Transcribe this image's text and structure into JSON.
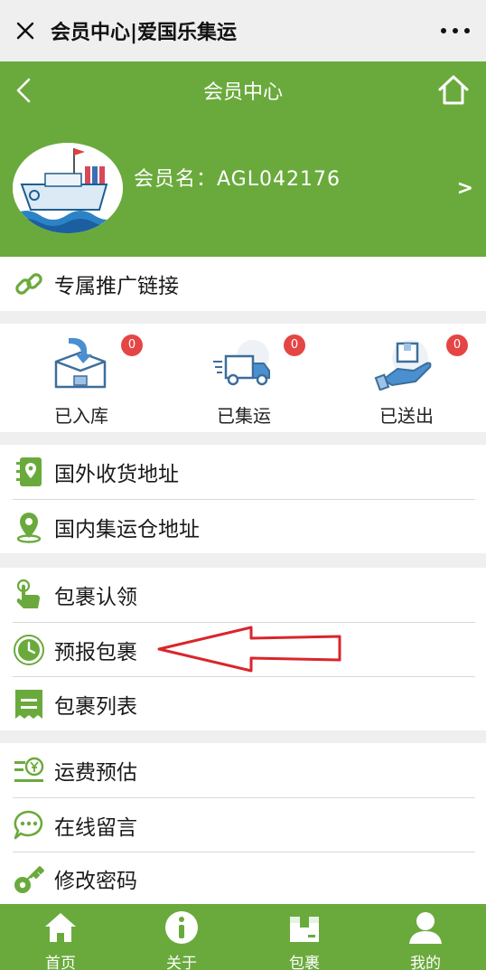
{
  "window": {
    "title": "会员中心|爱国乐集运"
  },
  "navbar": {
    "title": "会员中心"
  },
  "profile": {
    "username": "会员名：AGL042176",
    "arrow": ">"
  },
  "promo": {
    "label": "专属推广链接"
  },
  "stats": [
    {
      "label": "已入库",
      "count": "0"
    },
    {
      "label": "已集运",
      "count": "0"
    },
    {
      "label": "已送出",
      "count": "0"
    }
  ],
  "menu_group1": [
    {
      "label": "国外收货地址",
      "icon": "address-book-pin-icon"
    },
    {
      "label": "国内集运仓地址",
      "icon": "map-pin-icon"
    }
  ],
  "menu_group2": [
    {
      "label": "包裹认领",
      "icon": "hand-pointer-icon"
    },
    {
      "label": "预报包裹",
      "icon": "clock-icon"
    },
    {
      "label": "包裹列表",
      "icon": "list-receipt-icon"
    }
  ],
  "menu_group3": [
    {
      "label": "运费预估",
      "icon": "yen-estimate-icon"
    },
    {
      "label": "在线留言",
      "icon": "chat-bubble-icon"
    },
    {
      "label": "修改密码",
      "icon": "key-icon"
    }
  ],
  "tabbar": [
    {
      "label": "首页",
      "icon": "home-icon"
    },
    {
      "label": "关于",
      "icon": "info-icon"
    },
    {
      "label": "包裹",
      "icon": "package-icon"
    },
    {
      "label": "我的",
      "icon": "user-icon"
    }
  ],
  "colors": {
    "brand_green": "#6aaa3c",
    "badge_red": "#e64545",
    "annotation_red": "#d9262c"
  }
}
